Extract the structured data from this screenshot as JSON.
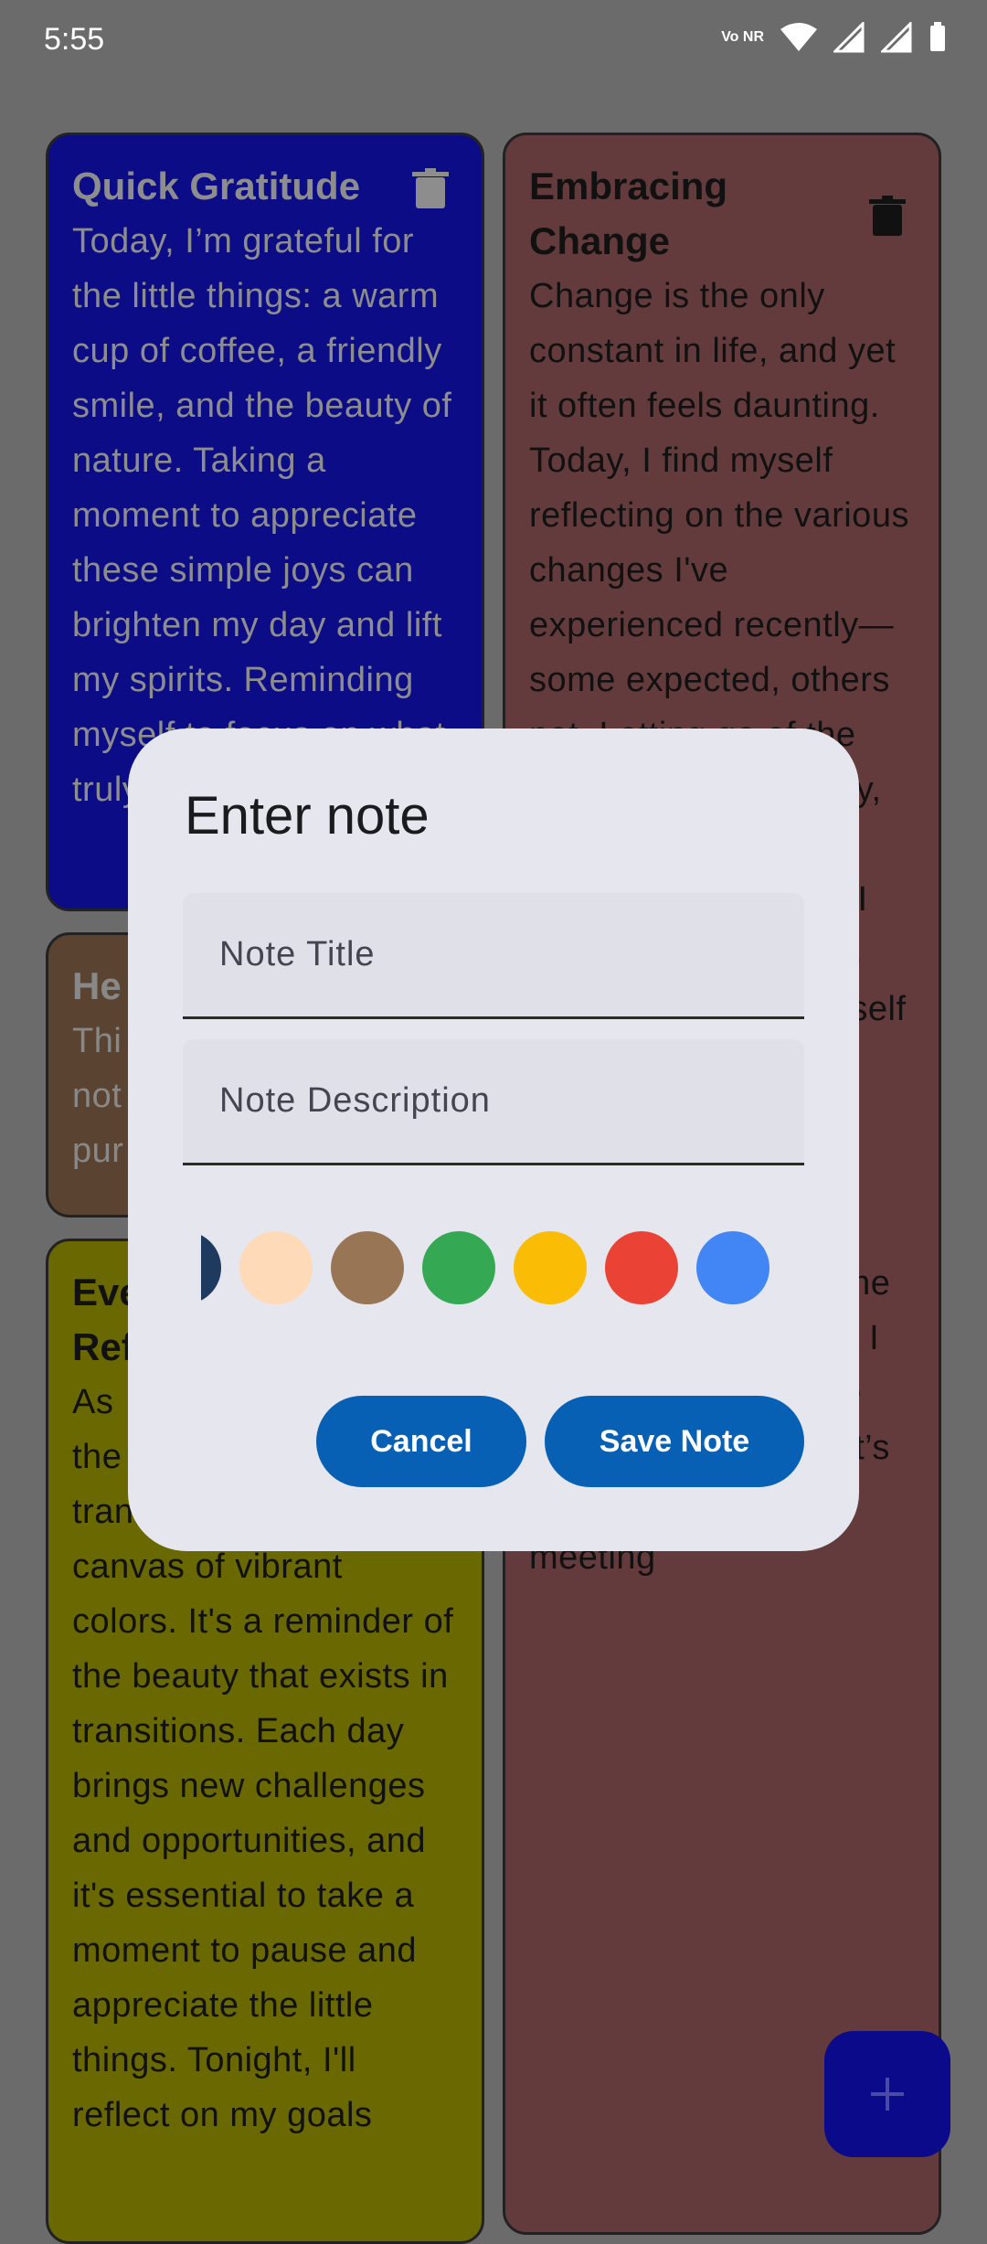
{
  "status_bar": {
    "time": "5:55",
    "network_label": "Vo NR"
  },
  "notes": [
    {
      "title": "Quick Gratitude",
      "body": "Today, I’m grateful for the little things: a warm cup of coffee, a friendly smile, and the beauty of nature. Taking a moment to appreciate these simple joys can brighten my day and lift my spirits. Reminding myself to focus on what truly matters in t",
      "color": "#0c0c86"
    },
    {
      "title": "Embracing Change",
      "body": "Change is the only constant in life, and yet it often feels daunting. Today, I find myself reflecting on the various changes I've experienced recently—some expected, others not. Letting go of the past isn't always easy, but it opens doors to new possibilities. As I navigate through this journey, I remind myself to stay curious and resilient.\n\nToday, I will take a moment to identify one area in my life where I can embrace change more fully. Whether it’s trying a new hobby, meeting",
      "color": "#643b3c"
    },
    {
      "title": "He",
      "body": "Thi\nnot\npur",
      "color": "#5a4431"
    },
    {
      "title": "Eve\nRef",
      "body": "As\nthe\ntran\ncanvas of vibrant colors. It's a reminder of the beauty that exists in transitions. Each day brings new challenges and opportunities, and it's essential to take a moment to pause and appreciate the little things. Tonight, I'll reflect on my goals",
      "color": "#6a6800"
    }
  ],
  "dialog": {
    "title": "Enter note",
    "title_placeholder": "Note Title",
    "description_placeholder": "Note Description",
    "cancel_label": "Cancel",
    "save_label": "Save Note",
    "color_options": [
      "#1f3a5f",
      "#ffdab9",
      "#987554",
      "#34a853",
      "#fbbc05",
      "#ea4335",
      "#4285f4",
      "#ff4d6d"
    ]
  },
  "fab": {
    "icon": "plus-icon"
  },
  "colors": {
    "accent": "#0760b4",
    "dialog_bg": "#e5e6ee",
    "scrim": "#6b6b6b"
  }
}
